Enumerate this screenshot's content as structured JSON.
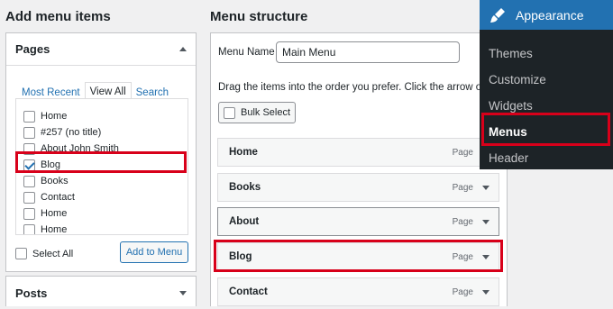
{
  "left": {
    "heading": "Add menu items",
    "pages_box": {
      "title": "Pages",
      "tabs": [
        "Most Recent",
        "View All",
        "Search"
      ],
      "items": [
        {
          "label": "Home",
          "checked": false
        },
        {
          "label": "#257 (no title)",
          "checked": false
        },
        {
          "label": "About John Smith",
          "checked": false
        },
        {
          "label": "Blog",
          "checked": true
        },
        {
          "label": "Books",
          "checked": false
        },
        {
          "label": "Contact",
          "checked": false
        },
        {
          "label": "Home",
          "checked": false
        },
        {
          "label": "Home",
          "checked": false
        }
      ],
      "select_all": "Select All",
      "add_button": "Add to Menu"
    },
    "posts_box": {
      "title": "Posts"
    }
  },
  "middle": {
    "heading": "Menu structure",
    "menu_name_label": "Menu Name",
    "menu_name_value": "Main Menu",
    "instructions": "Drag the items into the order you prefer. Click the arrow on the r",
    "bulk_select": "Bulk Select",
    "items": [
      {
        "title": "Home",
        "type": "Page"
      },
      {
        "title": "Books",
        "type": "Page"
      },
      {
        "title": "About",
        "type": "Page"
      },
      {
        "title": "Blog",
        "type": "Page"
      },
      {
        "title": "Contact",
        "type": "Page"
      }
    ]
  },
  "admin_menu": {
    "section": "Appearance",
    "items": [
      "Themes",
      "Customize",
      "Widgets",
      "Menus",
      "Header"
    ],
    "current": "Menus",
    "accent": "#2271b1",
    "highlight": "#d8001a"
  }
}
